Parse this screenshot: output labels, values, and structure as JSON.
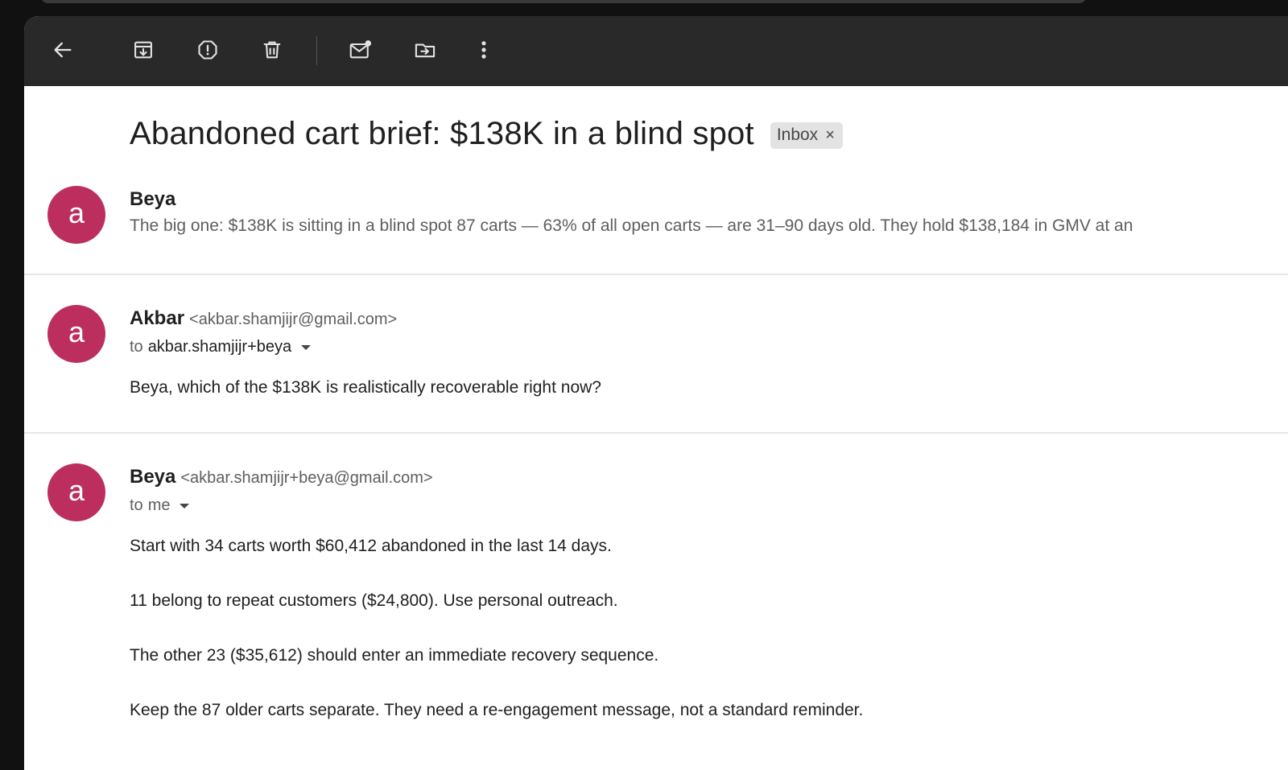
{
  "toolbar": {
    "buttons": [
      {
        "name": "back-icon"
      },
      {
        "name": "archive-icon"
      },
      {
        "name": "report-spam-icon"
      },
      {
        "name": "delete-icon"
      },
      {
        "name": "mark-unread-icon"
      },
      {
        "name": "move-to-icon"
      },
      {
        "name": "more-vert-icon"
      }
    ]
  },
  "thread": {
    "subject": "Abandoned cart brief: $138K in a blind spot",
    "label": "Inbox",
    "label_remove": "×"
  },
  "messages": [
    {
      "avatar": "a",
      "sender": "Beya",
      "snippet": "The big one: $138K is sitting in a blind spot 87 carts — 63% of all open carts — are 31–90 days old. They hold $138,184 in GMV at an"
    },
    {
      "avatar": "a",
      "sender": "Akbar",
      "email": "<akbar.shamjijr@gmail.com>",
      "to_prefix": "to",
      "to": "akbar.shamjijr+beya",
      "body": [
        "Beya, which of the $138K is realistically recoverable right now?"
      ]
    },
    {
      "avatar": "a",
      "sender": "Beya",
      "email": "<akbar.shamjijr+beya@gmail.com>",
      "to_prefix": "to",
      "to": "me",
      "body": [
        "Start with 34 carts worth $60,412 abandoned in the last 14 days.",
        "11 belong to repeat customers ($24,800). Use personal outreach.",
        "The other 23 ($35,612) should enter an immediate recovery sequence.",
        "Keep the 87 older carts separate. They need a re-engagement message, not a standard reminder."
      ]
    }
  ],
  "colors": {
    "toolbar_bg": "#292929",
    "avatar_bg": "#bc2e5e",
    "chip_bg": "#e3e3e3",
    "text_primary": "#1f1f1f",
    "text_secondary": "#5e5e5e"
  }
}
